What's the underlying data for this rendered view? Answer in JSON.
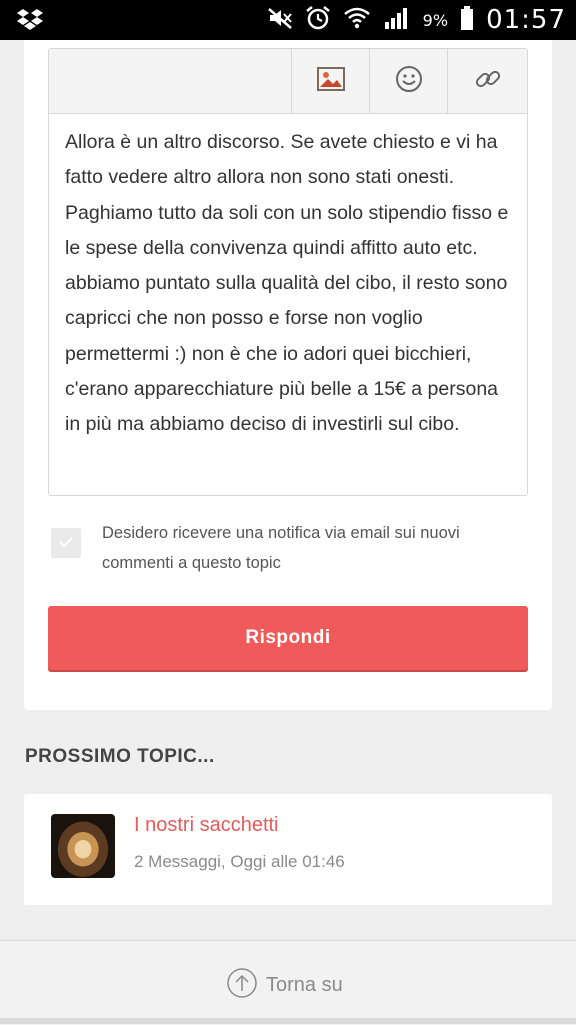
{
  "status_bar": {
    "battery_percent": "9%",
    "time": "01:57",
    "icons": [
      "dropbox-icon",
      "mute-icon",
      "alarm-icon",
      "wifi-icon",
      "signal-icon",
      "battery-icon"
    ]
  },
  "editor": {
    "toolbar_icons": [
      "image-icon",
      "emoji-icon",
      "link-icon"
    ],
    "text": "Allora è un altro discorso. Se avete chiesto e vi ha fatto vedere altro allora non sono stati onesti. Paghiamo tutto da soli con un solo stipendio fisso e le spese della convivenza quindi affitto auto etc. abbiamo puntato sulla qualità del cibo, il resto sono capricci che non posso e forse non voglio permettermi :) non è che io adori quei bicchieri, c'erano apparecchiature più belle a 15€ a persona in più ma abbiamo deciso di investirli sul cibo."
  },
  "notify": {
    "checked": true,
    "label": "Desidero ricevere una notifica via email sui nuovi commenti a questo topic"
  },
  "reply_button": {
    "label": "Rispondi",
    "color": "#f05a5a"
  },
  "next_topic": {
    "heading": "PROSSIMO TOPIC...",
    "title": "I nostri sacchetti",
    "meta": "2 Messaggi, Oggi alle 01:46",
    "title_color": "#e05b5b"
  },
  "footer": {
    "back_to_top": "Torna su"
  }
}
